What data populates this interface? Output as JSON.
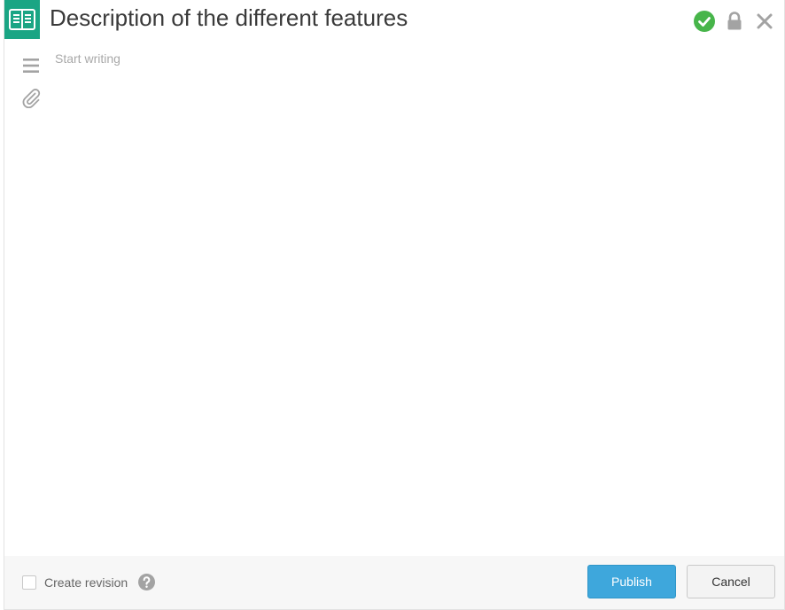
{
  "header": {
    "title": "Description of the different features",
    "app_icon": "open-book-icon",
    "status_icon": "check-circle-icon",
    "lock_icon": "lock-icon",
    "close_icon": "close-icon"
  },
  "toolbar": {
    "tools": [
      "menu-icon",
      "paperclip-icon"
    ]
  },
  "editor": {
    "placeholder": "Start writing",
    "value": ""
  },
  "footer": {
    "create_revision_label": "Create revision",
    "create_revision_checked": false,
    "publish_label": "Publish",
    "cancel_label": "Cancel"
  },
  "colors": {
    "brand": "#1aa584",
    "success": "#47b54a",
    "primary": "#3ea7dc",
    "icon_gray": "#a3a3a3"
  }
}
